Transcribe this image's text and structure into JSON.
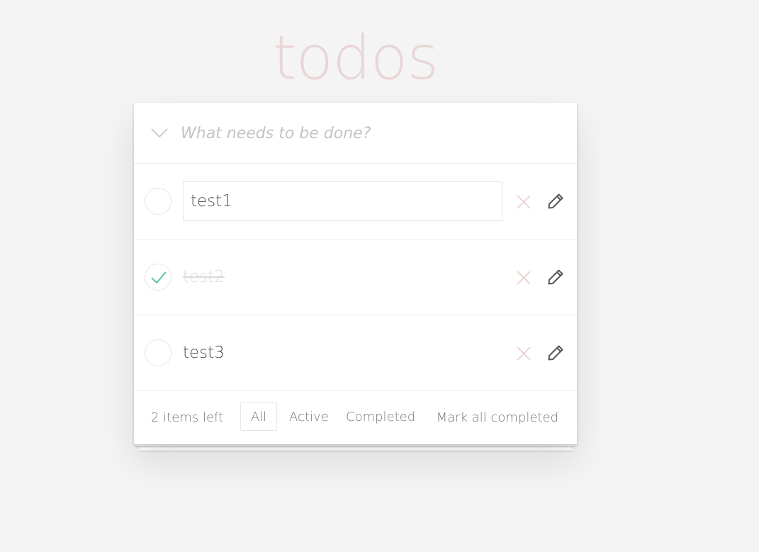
{
  "app": {
    "title": "todos"
  },
  "new_todo": {
    "placeholder": "What needs to be done?"
  },
  "todos": [
    {
      "title": "test1",
      "completed": false,
      "editing": true
    },
    {
      "title": "test2",
      "completed": true,
      "editing": false
    },
    {
      "title": "test3",
      "completed": false,
      "editing": false
    }
  ],
  "footer": {
    "items_left": "2 items left",
    "filters": {
      "all": "All",
      "active": "Active",
      "completed": "Completed"
    },
    "selected_filter": "All",
    "mark_all": "Mark all completed"
  },
  "colors": {
    "title": "#eadada",
    "check": "#5dc2af",
    "destroy": "#eccfcf",
    "edit_icon": "#555555",
    "background": "#f4f4f4"
  },
  "icons": {
    "toggle_all": "chevron-down-icon",
    "check": "check-icon",
    "destroy": "close-icon",
    "edit": "pencil-icon"
  }
}
